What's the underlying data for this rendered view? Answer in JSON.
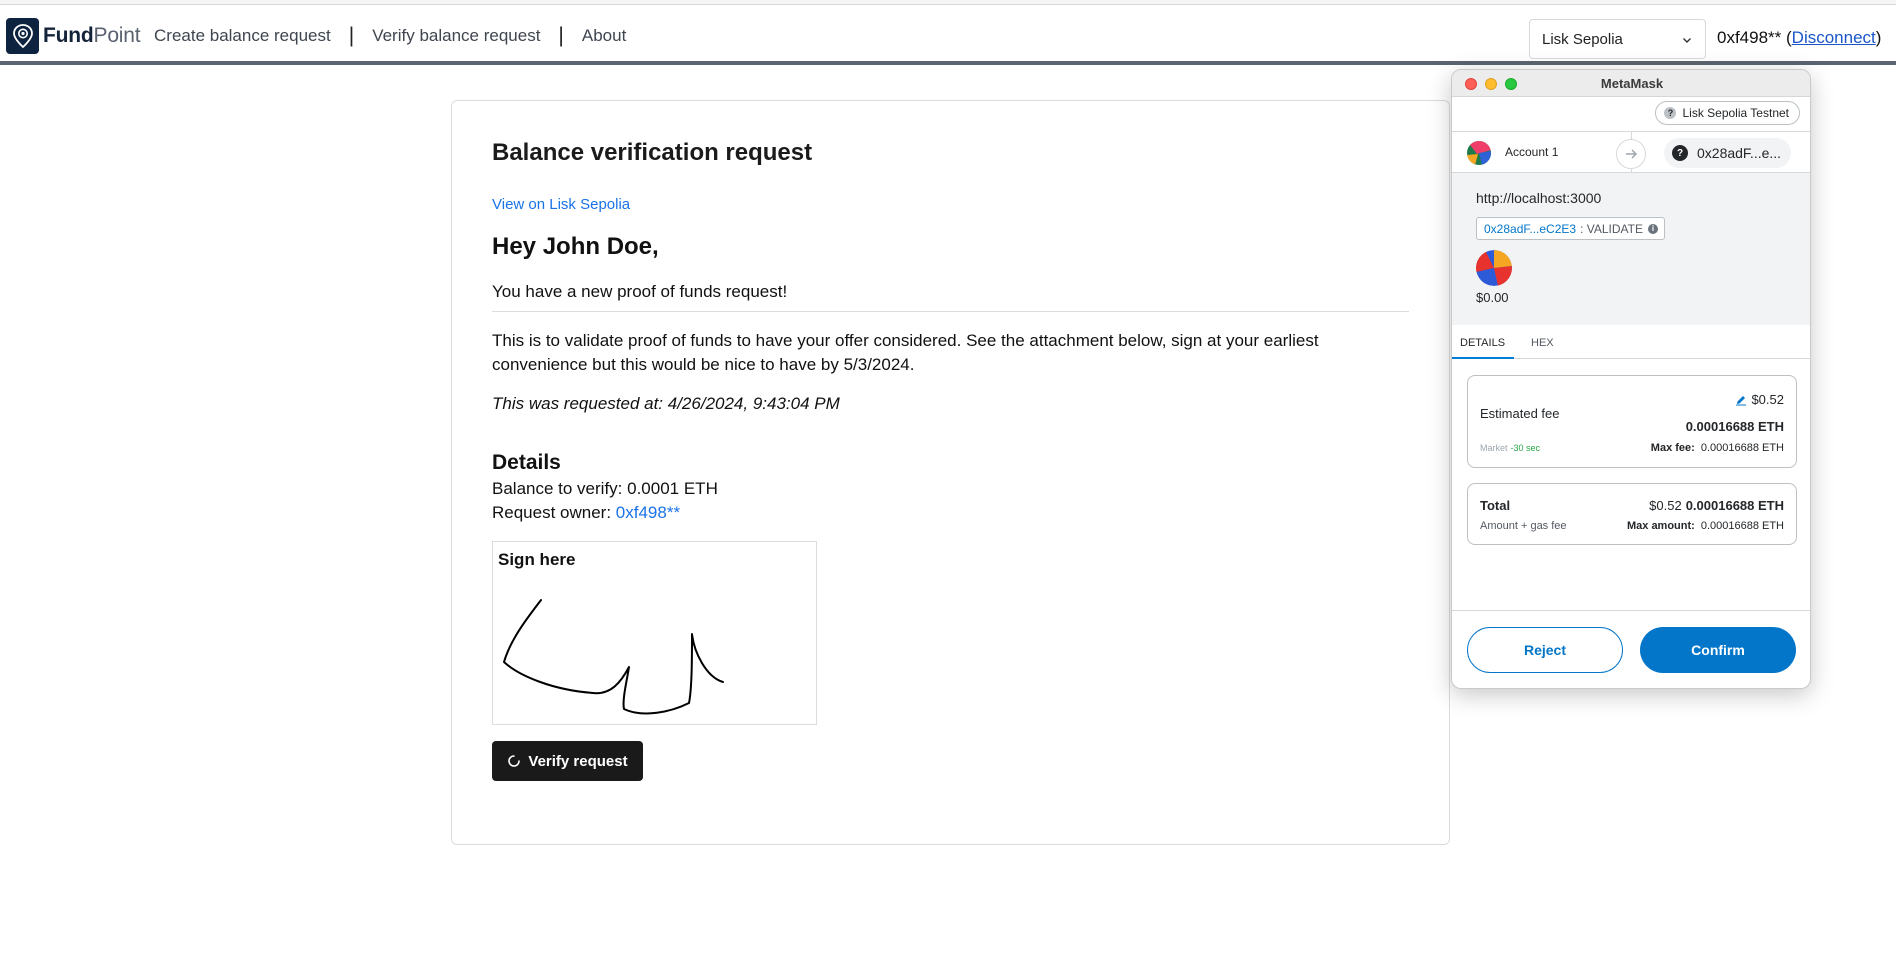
{
  "navbar": {
    "brand_bold": "Fund",
    "brand_light": "Point",
    "links": [
      "Create balance request",
      "Verify balance request",
      "About"
    ],
    "separator": "|",
    "network_selected": "Lisk Sepolia",
    "wallet_address": "0xf498**",
    "open_paren": " (",
    "disconnect_label": "Disconnect",
    "close_paren": ")"
  },
  "card": {
    "title": "Balance verification request",
    "view_link": "View on Lisk Sepolia",
    "greeting": "Hey John Doe,",
    "subline": "You have a new proof of funds request!",
    "paragraph": "This is to validate proof of funds to have your offer considered. See the attachment below, sign at your earliest convenience but this would be nice to have by 5/3/2024.",
    "requested_at": "This was requested at: 4/26/2024, 9:43:04 PM",
    "details_title": "Details",
    "balance_label": "Balance to verify: ",
    "balance_value": "0.0001 ETH",
    "owner_label": "Request owner: ",
    "owner_value": "0xf498**",
    "sign_label": "Sign here",
    "verify_button": "Verify request"
  },
  "metamask": {
    "window_title": "MetaMask",
    "network": "Lisk Sepolia Testnet",
    "account_name": "Account 1",
    "target_address": "0x28adF...e...",
    "origin": "http://localhost:3000",
    "method_address": "0x28adF...eC2E3",
    "method_name": ": VALIDATE",
    "amount": "$0.00",
    "tabs": [
      "DETAILS",
      "HEX"
    ],
    "fee": {
      "label": "Estimated fee",
      "usd": "$0.52",
      "eth": "0.00016688 ETH",
      "market": "Market",
      "market_time": "-30 sec",
      "max_fee_label": "Max fee:",
      "max_fee_value": "0.00016688 ETH"
    },
    "total": {
      "label": "Total",
      "usd": "$0.52",
      "eth": "0.00016688 ETH",
      "sub_label": "Amount + gas fee",
      "max_amount_label": "Max amount:",
      "max_amount_value": "0.00016688 ETH"
    },
    "reject_button": "Reject",
    "confirm_button": "Confirm"
  },
  "colors": {
    "nav_border": "#5b6470",
    "link_blue": "#1a73e8",
    "metamask_blue": "#0376c9",
    "button_dark": "#1a1a1a"
  }
}
